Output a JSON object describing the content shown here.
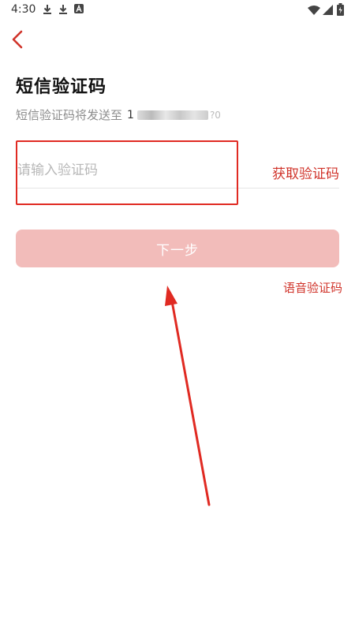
{
  "status_bar": {
    "time": "4:30",
    "left_icons": [
      "download-icon",
      "download-icon",
      "app-icon"
    ],
    "right_icons": [
      "wifi-icon",
      "signal-icon",
      "battery-icon"
    ]
  },
  "header": {
    "back_icon": "chevron-left-icon"
  },
  "page": {
    "title": "短信验证码",
    "subtitle": "短信验证码将发送至",
    "phone_prefix": "1",
    "phone_suffix": "?0"
  },
  "form": {
    "code_placeholder": "请输入验证码",
    "code_value": "",
    "get_code_label": "获取验证码",
    "next_label": "下一步",
    "voice_code_label": "语音验证码"
  },
  "colors": {
    "accent": "#d0332a",
    "button_disabled": "#f2bcba",
    "annotation": "#e02a22"
  }
}
